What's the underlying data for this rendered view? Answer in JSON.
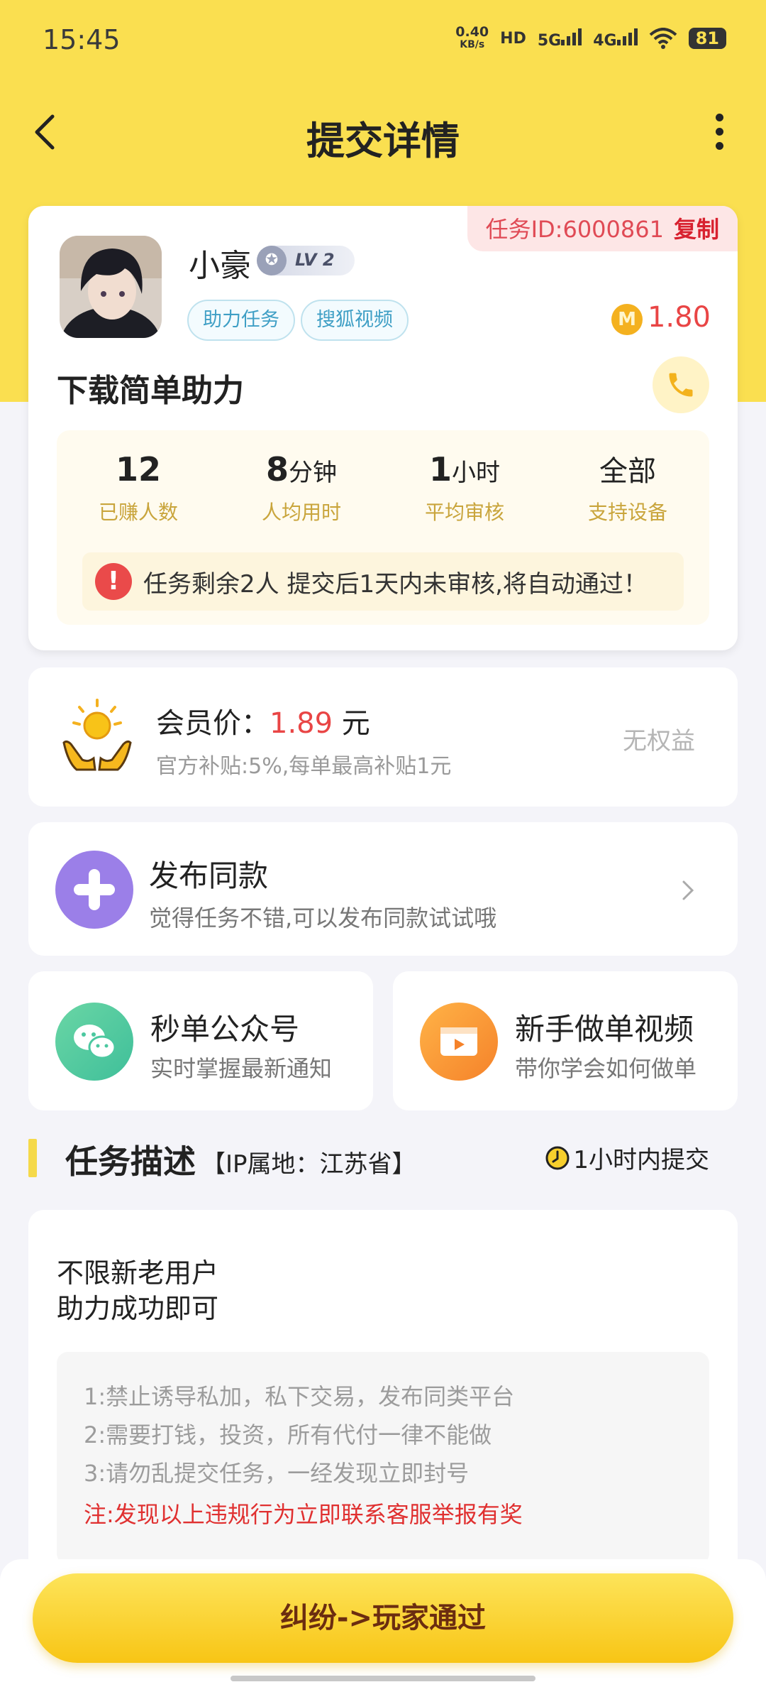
{
  "status_bar": {
    "time": "15:45",
    "net_speed_value": "0.40",
    "net_speed_unit": "KB/s",
    "hd": "HD",
    "signal1": "5G",
    "signal2": "4G",
    "battery": "81"
  },
  "header": {
    "title": "提交详情"
  },
  "task_card": {
    "task_id": "任务ID:6000861",
    "copy_label": "复制",
    "username": "小豪",
    "level": "LV 2",
    "tags": [
      "助力任务",
      "搜狐视频"
    ],
    "coin_symbol": "M",
    "reward": "1.80",
    "task_title": "下载简单助力",
    "stats": [
      {
        "value": "12",
        "unit": "",
        "label": "已赚人数"
      },
      {
        "value": "8",
        "unit": "分钟",
        "label": "人均用时"
      },
      {
        "value": "1",
        "unit": "小时",
        "label": "平均审核"
      },
      {
        "value": "全部",
        "unit": "",
        "label": "支持设备"
      }
    ],
    "notice": "任务剩余2人  提交后1天内未审核,将自动通过！"
  },
  "member": {
    "label": "会员价：",
    "price": "1.89",
    "unit": "元",
    "subtitle": "官方补贴:5%,每单最高补贴1元",
    "right": "无权益"
  },
  "publish": {
    "title": "发布同款",
    "subtitle": "觉得任务不错,可以发布同款试试哦"
  },
  "wechat": {
    "title": "秒单公众号",
    "subtitle": "实时掌握最新通知"
  },
  "video": {
    "title": "新手做单视频",
    "subtitle": "带你学会如何做单"
  },
  "section": {
    "title": "任务描述",
    "ip": "【IP属地：江苏省】",
    "time": "1小时内提交"
  },
  "description": {
    "lines": [
      "不限新老用户",
      "助力成功即可"
    ],
    "rules": [
      "1:禁止诱导私加，私下交易，发布同类平台",
      "2:需要打钱，投资，所有代付一律不能做",
      "3:请勿乱提交任务，一经发现立即封号"
    ],
    "warning": "注:发现以上违规行为立即联系客服举报有奖"
  },
  "action": {
    "label": "纠纷->玩家通过"
  },
  "colors": {
    "accent": "#fadf50",
    "price_red": "#e94545",
    "tag_blue": "#3f9fc5",
    "gold": "#c9a53c"
  }
}
